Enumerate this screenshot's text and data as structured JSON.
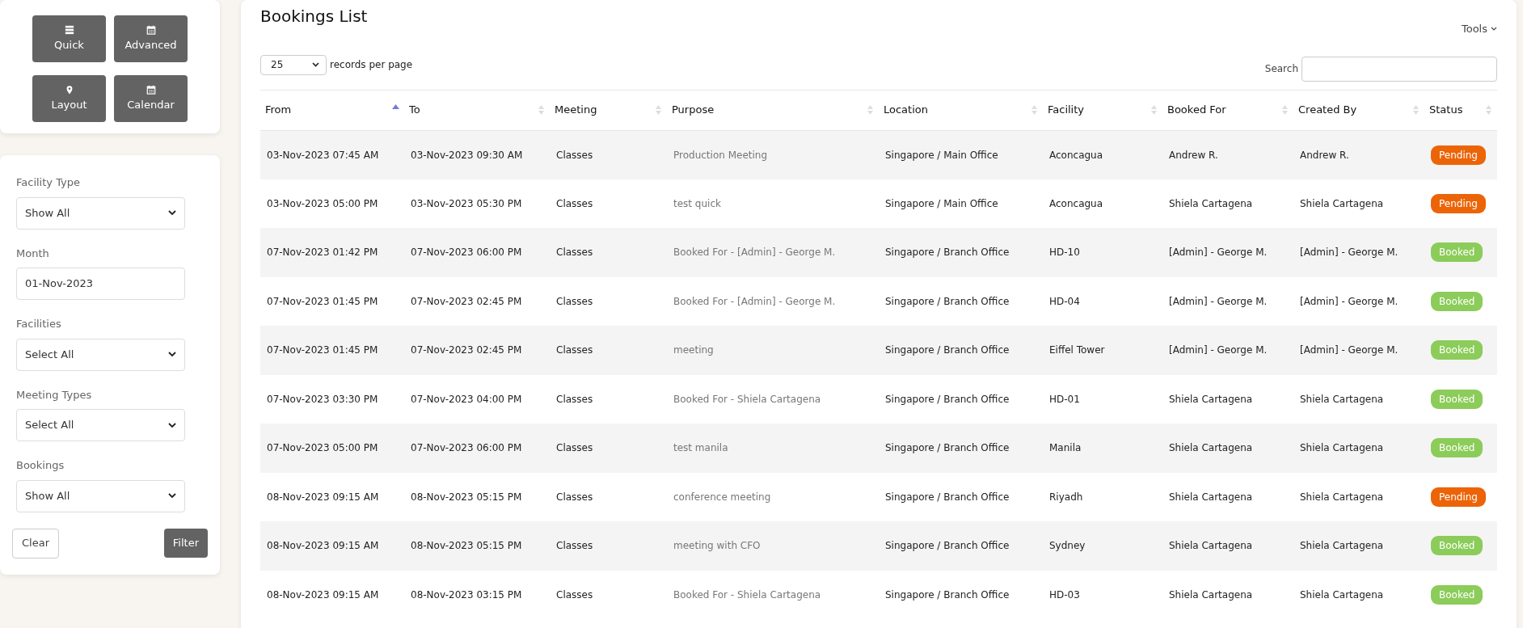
{
  "quick_buttons": [
    {
      "label": "Quick"
    },
    {
      "label": "Advanced"
    },
    {
      "label": "Layout"
    },
    {
      "label": "Calendar"
    }
  ],
  "filters": [
    {
      "kind": "select",
      "label": "Facility Type",
      "value": "Show All"
    },
    {
      "kind": "input",
      "label": "Month",
      "value": "01-Nov-2023"
    },
    {
      "kind": "select",
      "label": "Facilities",
      "value": "Select All"
    },
    {
      "kind": "select",
      "label": "Meeting Types",
      "value": "Select All"
    },
    {
      "kind": "select",
      "label": "Bookings",
      "value": "Show All"
    }
  ],
  "filter_actions": {
    "clear": "Clear",
    "filter": "Filter"
  },
  "main": {
    "title": "Bookings List",
    "tools": "Tools",
    "page_size": "25",
    "page_size_label": "records per page",
    "search_label": "Search"
  },
  "table": {
    "columns": [
      {
        "label": "From",
        "sorted": true
      },
      {
        "label": "To",
        "sorted": false
      },
      {
        "label": "Meeting",
        "sorted": false
      },
      {
        "label": "Purpose",
        "sorted": false
      },
      {
        "label": "Location",
        "sorted": false
      },
      {
        "label": "Facility",
        "sorted": false
      },
      {
        "label": "Booked For",
        "sorted": false
      },
      {
        "label": "Created By",
        "sorted": false
      },
      {
        "label": "Status",
        "sorted": false
      }
    ],
    "rows": [
      {
        "cells": [
          "03-Nov-2023 07:45 AM",
          "03-Nov-2023 09:30 AM",
          "Classes",
          "Production Meeting",
          "Singapore / Main Office",
          "Aconcagua",
          "Andrew R.",
          "Andrew R."
        ],
        "status": "Pending",
        "color": "#ec6408"
      },
      {
        "cells": [
          "03-Nov-2023 05:00 PM",
          "03-Nov-2023 05:30 PM",
          "Classes",
          "test quick",
          "Singapore / Main Office",
          "Aconcagua",
          "Shiela Cartagena",
          "Shiela Cartagena"
        ],
        "status": "Pending",
        "color": "#ec6408"
      },
      {
        "cells": [
          "07-Nov-2023 01:42 PM",
          "07-Nov-2023 06:00 PM",
          "Classes",
          "Booked For - [Admin] - George M.",
          "Singapore / Branch Office",
          "HD-10",
          "[Admin] - George M.",
          "[Admin] - George M."
        ],
        "status": "Booked",
        "color": "#8ccc5a"
      },
      {
        "cells": [
          "07-Nov-2023 01:45 PM",
          "07-Nov-2023 02:45 PM",
          "Classes",
          "Booked For - [Admin] - George M.",
          "Singapore / Branch Office",
          "HD-04",
          "[Admin] - George M.",
          "[Admin] - George M."
        ],
        "status": "Booked",
        "color": "#8ccc5a"
      },
      {
        "cells": [
          "07-Nov-2023 01:45 PM",
          "07-Nov-2023 02:45 PM",
          "Classes",
          "meeting",
          "Singapore / Branch Office",
          "Eiffel Tower",
          "[Admin] - George M.",
          "[Admin] - George M."
        ],
        "status": "Booked",
        "color": "#8ccc5a"
      },
      {
        "cells": [
          "07-Nov-2023 03:30 PM",
          "07-Nov-2023 04:00 PM",
          "Classes",
          "Booked For - Shiela Cartagena",
          "Singapore / Branch Office",
          "HD-01",
          "Shiela Cartagena",
          "Shiela Cartagena"
        ],
        "status": "Booked",
        "color": "#8ccc5a"
      },
      {
        "cells": [
          "07-Nov-2023 05:00 PM",
          "07-Nov-2023 06:00 PM",
          "Classes",
          "test manila",
          "Singapore / Branch Office",
          "Manila",
          "Shiela Cartagena",
          "Shiela Cartagena"
        ],
        "status": "Booked",
        "color": "#8ccc5a"
      },
      {
        "cells": [
          "08-Nov-2023 09:15 AM",
          "08-Nov-2023 05:15 PM",
          "Classes",
          "conference meeting",
          "Singapore / Branch Office",
          "Riyadh",
          "Shiela Cartagena",
          "Shiela Cartagena"
        ],
        "status": "Pending",
        "color": "#ec6408"
      },
      {
        "cells": [
          "08-Nov-2023 09:15 AM",
          "08-Nov-2023 05:15 PM",
          "Classes",
          "meeting with CFO",
          "Singapore / Branch Office",
          "Sydney",
          "Shiela Cartagena",
          "Shiela Cartagena"
        ],
        "status": "Booked",
        "color": "#8ccc5a"
      },
      {
        "cells": [
          "08-Nov-2023 09:15 AM",
          "08-Nov-2023 03:15 PM",
          "Classes",
          "Booked For - Shiela Cartagena",
          "Singapore / Branch Office",
          "HD-03",
          "Shiela Cartagena",
          "Shiela Cartagena"
        ],
        "status": "Booked",
        "color": "#8ccc5a"
      }
    ]
  }
}
